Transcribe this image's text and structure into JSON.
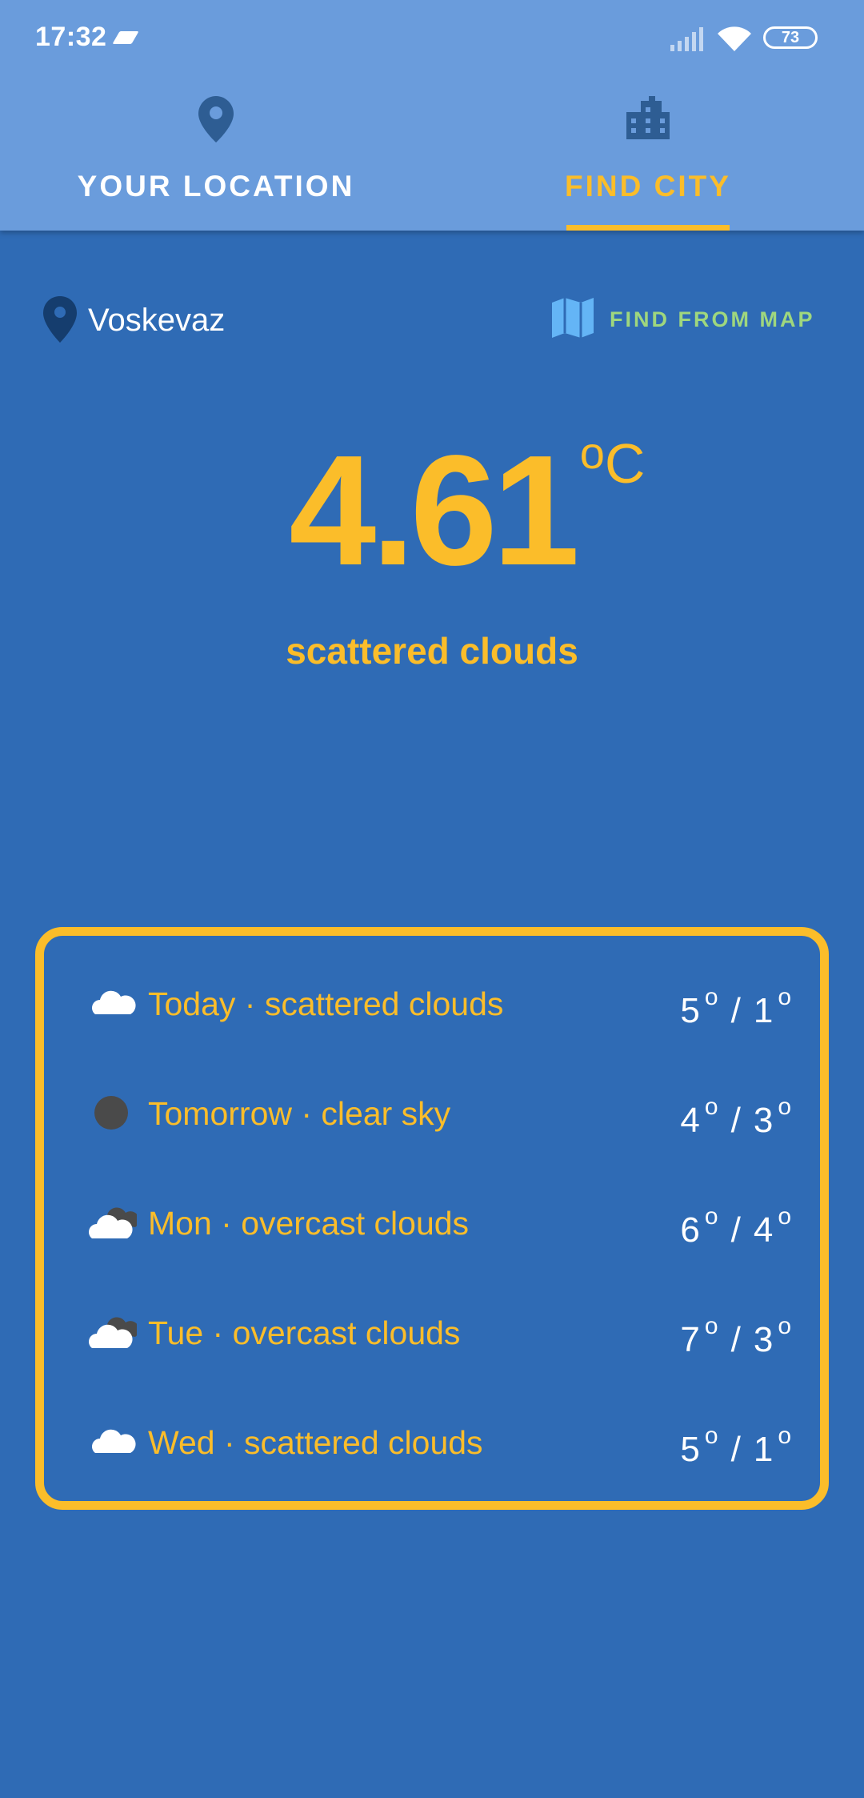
{
  "status_bar": {
    "time": "17:32",
    "battery": "73"
  },
  "tabs": [
    {
      "label": "YOUR LOCATION",
      "icon": "location-pin-icon",
      "selected": false
    },
    {
      "label": "FIND CITY",
      "icon": "city-icon",
      "selected": true
    }
  ],
  "location": {
    "name": "Voskevaz",
    "map_button_label": "FIND FROM MAP"
  },
  "current": {
    "temperature": "4.61",
    "unit_symbol": "o",
    "unit": "C",
    "description": "scattered clouds"
  },
  "forecast": [
    {
      "label": "Today · scattered clouds",
      "icon": "scattered-clouds-icon",
      "high": "5",
      "low": "1"
    },
    {
      "label": "Tomorrow · clear sky",
      "icon": "clear-sky-night-icon",
      "high": "4",
      "low": "3"
    },
    {
      "label": "Mon · overcast clouds",
      "icon": "overcast-clouds-icon",
      "high": "6",
      "low": "4"
    },
    {
      "label": "Tue · overcast clouds",
      "icon": "overcast-clouds-icon",
      "high": "7",
      "low": "3"
    },
    {
      "label": "Wed · scattered clouds",
      "icon": "scattered-clouds-icon",
      "high": "5",
      "low": "1"
    }
  ],
  "forecast_degree_symbol": "o",
  "forecast_separator": "/",
  "colors": {
    "background": "#2f6bb5",
    "header": "#6a9cdc",
    "accent": "#fbbd2a",
    "map_button": "#9fd77e"
  }
}
